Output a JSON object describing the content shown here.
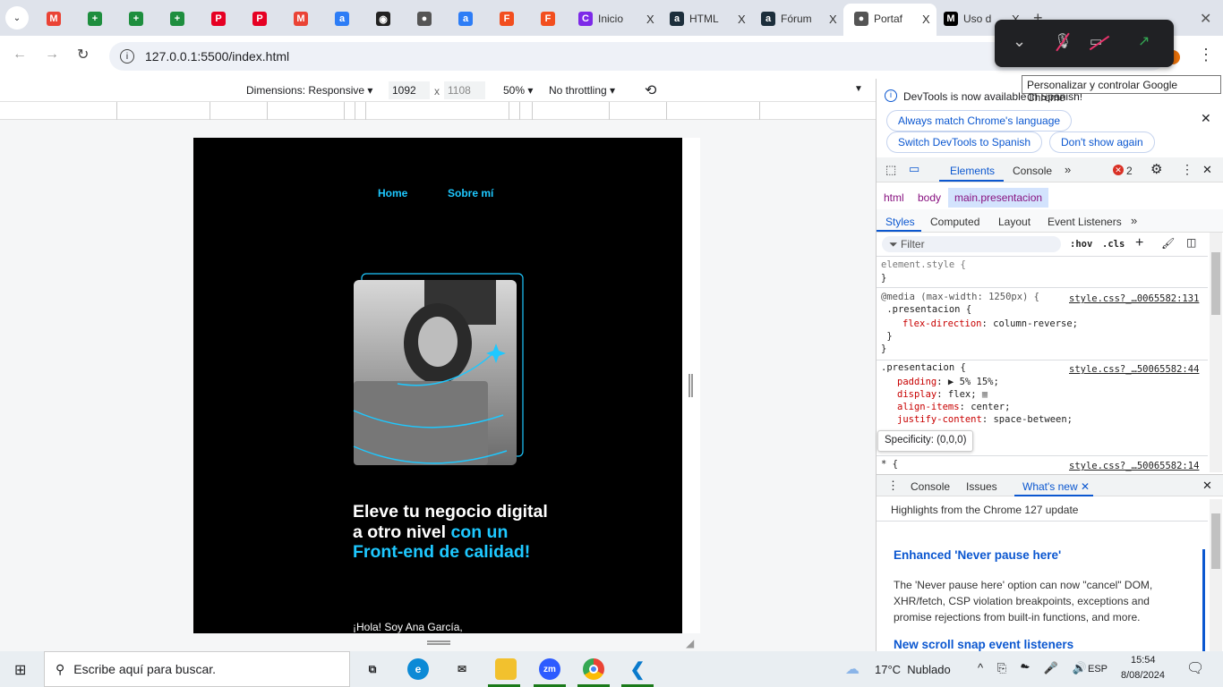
{
  "browser": {
    "tabs": [
      {
        "label": "",
        "icon": "gmail-icon",
        "color": "#ea4335"
      },
      {
        "label": "",
        "icon": "sheets-icon",
        "color": "#1e8e3e"
      },
      {
        "label": "",
        "icon": "sheets-icon",
        "color": "#1e8e3e"
      },
      {
        "label": "",
        "icon": "sheets-icon",
        "color": "#1e8e3e"
      },
      {
        "label": "",
        "icon": "pinterest-icon",
        "color": "#e60023"
      },
      {
        "label": "",
        "icon": "pinterest-icon",
        "color": "#e60023"
      },
      {
        "label": "",
        "icon": "gmail-icon",
        "color": "#ea4335"
      },
      {
        "label": "",
        "icon": "alura-icon",
        "color": "#2d7df6"
      },
      {
        "label": "",
        "icon": "github-icon",
        "color": "#222222"
      },
      {
        "label": "",
        "icon": "globe-icon",
        "color": "#555555"
      },
      {
        "label": "",
        "icon": "alura-icon",
        "color": "#2d7df6"
      },
      {
        "label": "",
        "icon": "figma-icon",
        "color": "#f24e1e"
      },
      {
        "label": "",
        "icon": "figma-icon",
        "color": "#f24e1e"
      },
      {
        "label": "Inicio",
        "icon": "canva-icon",
        "color": "#7d2ae8"
      },
      {
        "label": "HTML",
        "icon": "alura-icon",
        "color": "#1c2e3b"
      },
      {
        "label": "Fórum",
        "icon": "alura-icon",
        "color": "#1c2e3b"
      },
      {
        "label": "Portaf",
        "icon": "globe-icon",
        "color": "#555555",
        "active": true
      },
      {
        "label": "Uso d",
        "icon": "medium-icon",
        "color": "#000000"
      }
    ],
    "close_glyph": "X",
    "new_tab": "+",
    "url": "127.0.0.1:5500/index.html",
    "tooltip": "Personalizar y controlar Google Chrome"
  },
  "device_toolbar": {
    "dimensions": "Dimensions: Responsive",
    "width": "1092",
    "times": "x",
    "height": "1108",
    "zoom": "50%",
    "throttling": "No throttling"
  },
  "page": {
    "nav": [
      "Home",
      "Sobre mí"
    ],
    "headline_white": "Eleve tu negocio digital a otro nivel",
    "headline_accent": "con un Front-end de calidad!",
    "intro": "¡Hola! Soy Ana García,",
    "accent_color": "#1ec8ff"
  },
  "devtools": {
    "banner": "DevTools is now available in Spanish!",
    "banner_buttons": [
      "Always match Chrome's language",
      "Switch DevTools to Spanish",
      "Don't show again"
    ],
    "main_tabs": [
      "Elements",
      "Console"
    ],
    "error_count": "2",
    "breadcrumb": [
      "html",
      "body",
      "main.presentacion"
    ],
    "sub_tabs": [
      "Styles",
      "Computed",
      "Layout",
      "Event Listeners"
    ],
    "filter_placeholder": "Filter",
    "hov": ":hov",
    "cls": ".cls",
    "rules": [
      {
        "line1": "element.style {",
        "line2": "}"
      },
      {
        "media": "@media (max-width: 1250px) {",
        "selector": " .presentacion {",
        "props": [
          [
            "flex-direction",
            "column-reverse;"
          ]
        ],
        "end1": " }",
        "end2": "}",
        "source": "style.css?_…0065582:131"
      },
      {
        "selector": ".presentacion {",
        "props": [
          [
            "padding",
            "▶ 5% 15%;"
          ],
          [
            "display",
            "flex;"
          ],
          [
            "align-items",
            "center;"
          ],
          [
            "justify-content",
            "space-between;"
          ]
        ],
        "source": "style.css?_…50065582:44"
      },
      {
        "selector": "* {",
        "source": "style.css?_…50065582:14"
      }
    ],
    "specificity": "Specificity: (0,0,0)",
    "drawer_tabs": [
      "Console",
      "Issues",
      "What's new"
    ],
    "highlights": "Highlights from the Chrome 127 update",
    "article_title": "Enhanced 'Never pause here'",
    "article_body": "The 'Never pause here' option can now \"cancel\" DOM, XHR/fetch, CSP violation breakpoints, exceptions and promise rejections from built-in functions, and more.",
    "article2_title": "New scroll snap event listeners"
  },
  "taskbar": {
    "search_placeholder": "Escribe aquí para buscar.",
    "weather": "17°C  Nublado",
    "lang": "ESP",
    "time": "15:54",
    "date": "8/08/2024"
  }
}
